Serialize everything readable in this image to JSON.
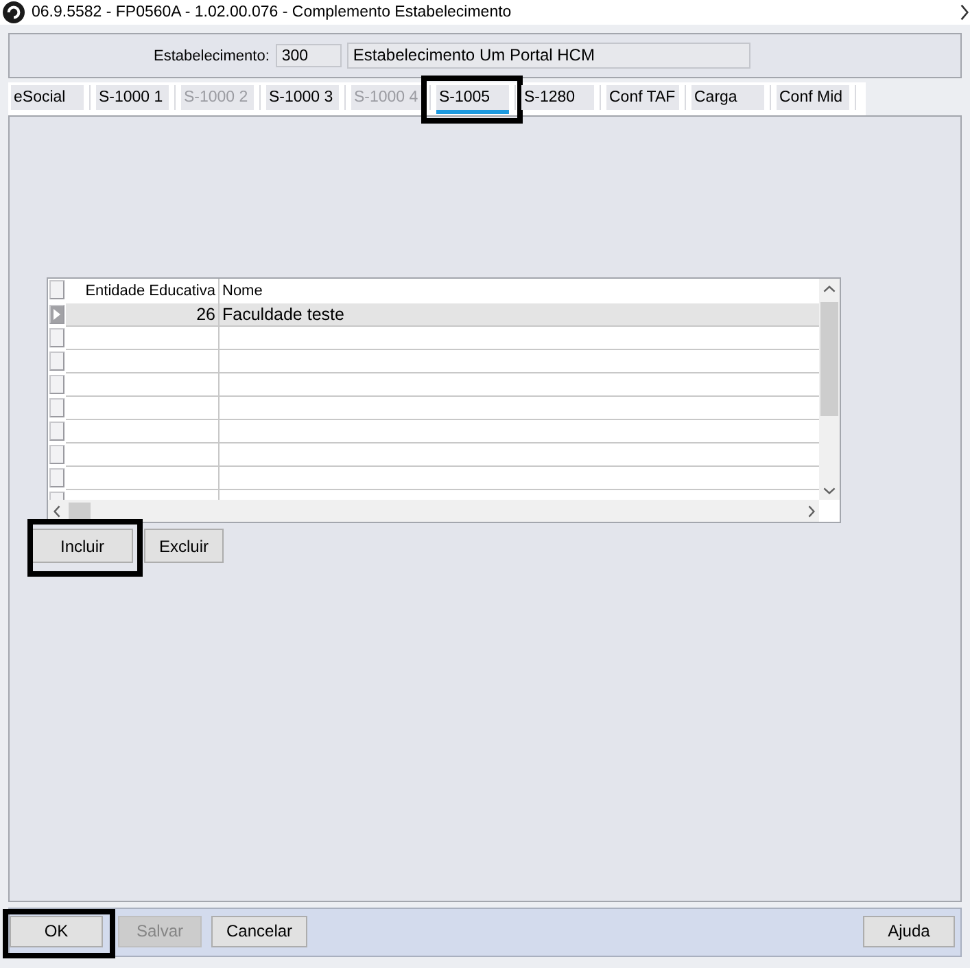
{
  "window": {
    "title": "06.9.5582 - FP0560A - 1.02.00.076 - Complemento Estabelecimento"
  },
  "header": {
    "label": "Estabelecimento:",
    "code": "300",
    "name": "Estabelecimento Um Portal HCM"
  },
  "tabs": [
    {
      "label": "eSocial",
      "selected": false,
      "disabled": false,
      "highlighted": false
    },
    {
      "label": "S-1000 1",
      "selected": false,
      "disabled": false,
      "highlighted": false
    },
    {
      "label": "S-1000 2",
      "selected": false,
      "disabled": true,
      "highlighted": false
    },
    {
      "label": "S-1000 3",
      "selected": false,
      "disabled": false,
      "highlighted": false
    },
    {
      "label": "S-1000 4",
      "selected": false,
      "disabled": true,
      "highlighted": false
    },
    {
      "label": "S-1005",
      "selected": true,
      "disabled": false,
      "highlighted": true
    },
    {
      "label": "S-1280",
      "selected": false,
      "disabled": false,
      "highlighted": false
    },
    {
      "label": "Conf TAF",
      "selected": false,
      "disabled": false,
      "highlighted": false
    },
    {
      "label": "Carga",
      "selected": false,
      "disabled": false,
      "highlighted": false
    },
    {
      "label": "Conf Mid",
      "selected": false,
      "disabled": false,
      "highlighted": false
    }
  ],
  "grid": {
    "columns": [
      "Entidade Educativa",
      "Nome"
    ],
    "rows": [
      {
        "cells": [
          "26",
          "Faculdade teste"
        ],
        "selected": true
      }
    ],
    "buttons": [
      {
        "label": "Incluir",
        "disabled": false,
        "highlighted": true
      },
      {
        "label": "Excluir",
        "disabled": false,
        "highlighted": false
      }
    ]
  },
  "footer": {
    "buttons": [
      {
        "label": "OK",
        "disabled": false,
        "highlighted": true
      },
      {
        "label": "Salvar",
        "disabled": true,
        "highlighted": false
      },
      {
        "label": "Cancelar",
        "disabled": false,
        "highlighted": false
      }
    ],
    "help_button": {
      "label": "Ajuda"
    }
  }
}
